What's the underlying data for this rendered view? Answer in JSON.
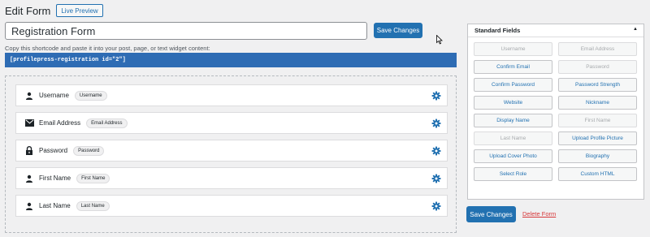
{
  "header": {
    "title": "Edit Form",
    "live_preview_label": "Live Preview"
  },
  "form": {
    "title_value": "Registration Form",
    "save_label": "Save Changes",
    "shortcode_hint": "Copy this shortcode and paste it into your post, page, or text widget content:",
    "shortcode": "[profilepress-registration id=\"2\"]"
  },
  "fields": [
    {
      "icon": "user-icon",
      "label": "Username",
      "tag": "Username"
    },
    {
      "icon": "envelope-icon",
      "label": "Email Address",
      "tag": "Email Address"
    },
    {
      "icon": "lock-icon",
      "label": "Password",
      "tag": "Password"
    },
    {
      "icon": "user-icon",
      "label": "First Name",
      "tag": "First Name"
    },
    {
      "icon": "user-icon",
      "label": "Last Name",
      "tag": "Last Name"
    }
  ],
  "standard_fields": {
    "title": "Standard Fields",
    "buttons": [
      {
        "label": "Username",
        "disabled": true
      },
      {
        "label": "Email Address",
        "disabled": true
      },
      {
        "label": "Confirm Email",
        "disabled": false
      },
      {
        "label": "Password",
        "disabled": true
      },
      {
        "label": "Confirm Password",
        "disabled": false
      },
      {
        "label": "Password Strength",
        "disabled": false
      },
      {
        "label": "Website",
        "disabled": false
      },
      {
        "label": "Nickname",
        "disabled": false
      },
      {
        "label": "Display Name",
        "disabled": false
      },
      {
        "label": "First Name",
        "disabled": true
      },
      {
        "label": "Last Name",
        "disabled": true
      },
      {
        "label": "Upload Profile Picture",
        "disabled": false
      },
      {
        "label": "Upload Cover Photo",
        "disabled": false
      },
      {
        "label": "Biography",
        "disabled": false
      },
      {
        "label": "Select Role",
        "disabled": false
      },
      {
        "label": "Custom HTML",
        "disabled": false
      }
    ]
  },
  "footer": {
    "save_label": "Save Changes",
    "delete_label": "Delete Form"
  },
  "colors": {
    "accent": "#2271b1",
    "shortcode_bg": "#2e6cb4",
    "delete": "#d63638"
  }
}
